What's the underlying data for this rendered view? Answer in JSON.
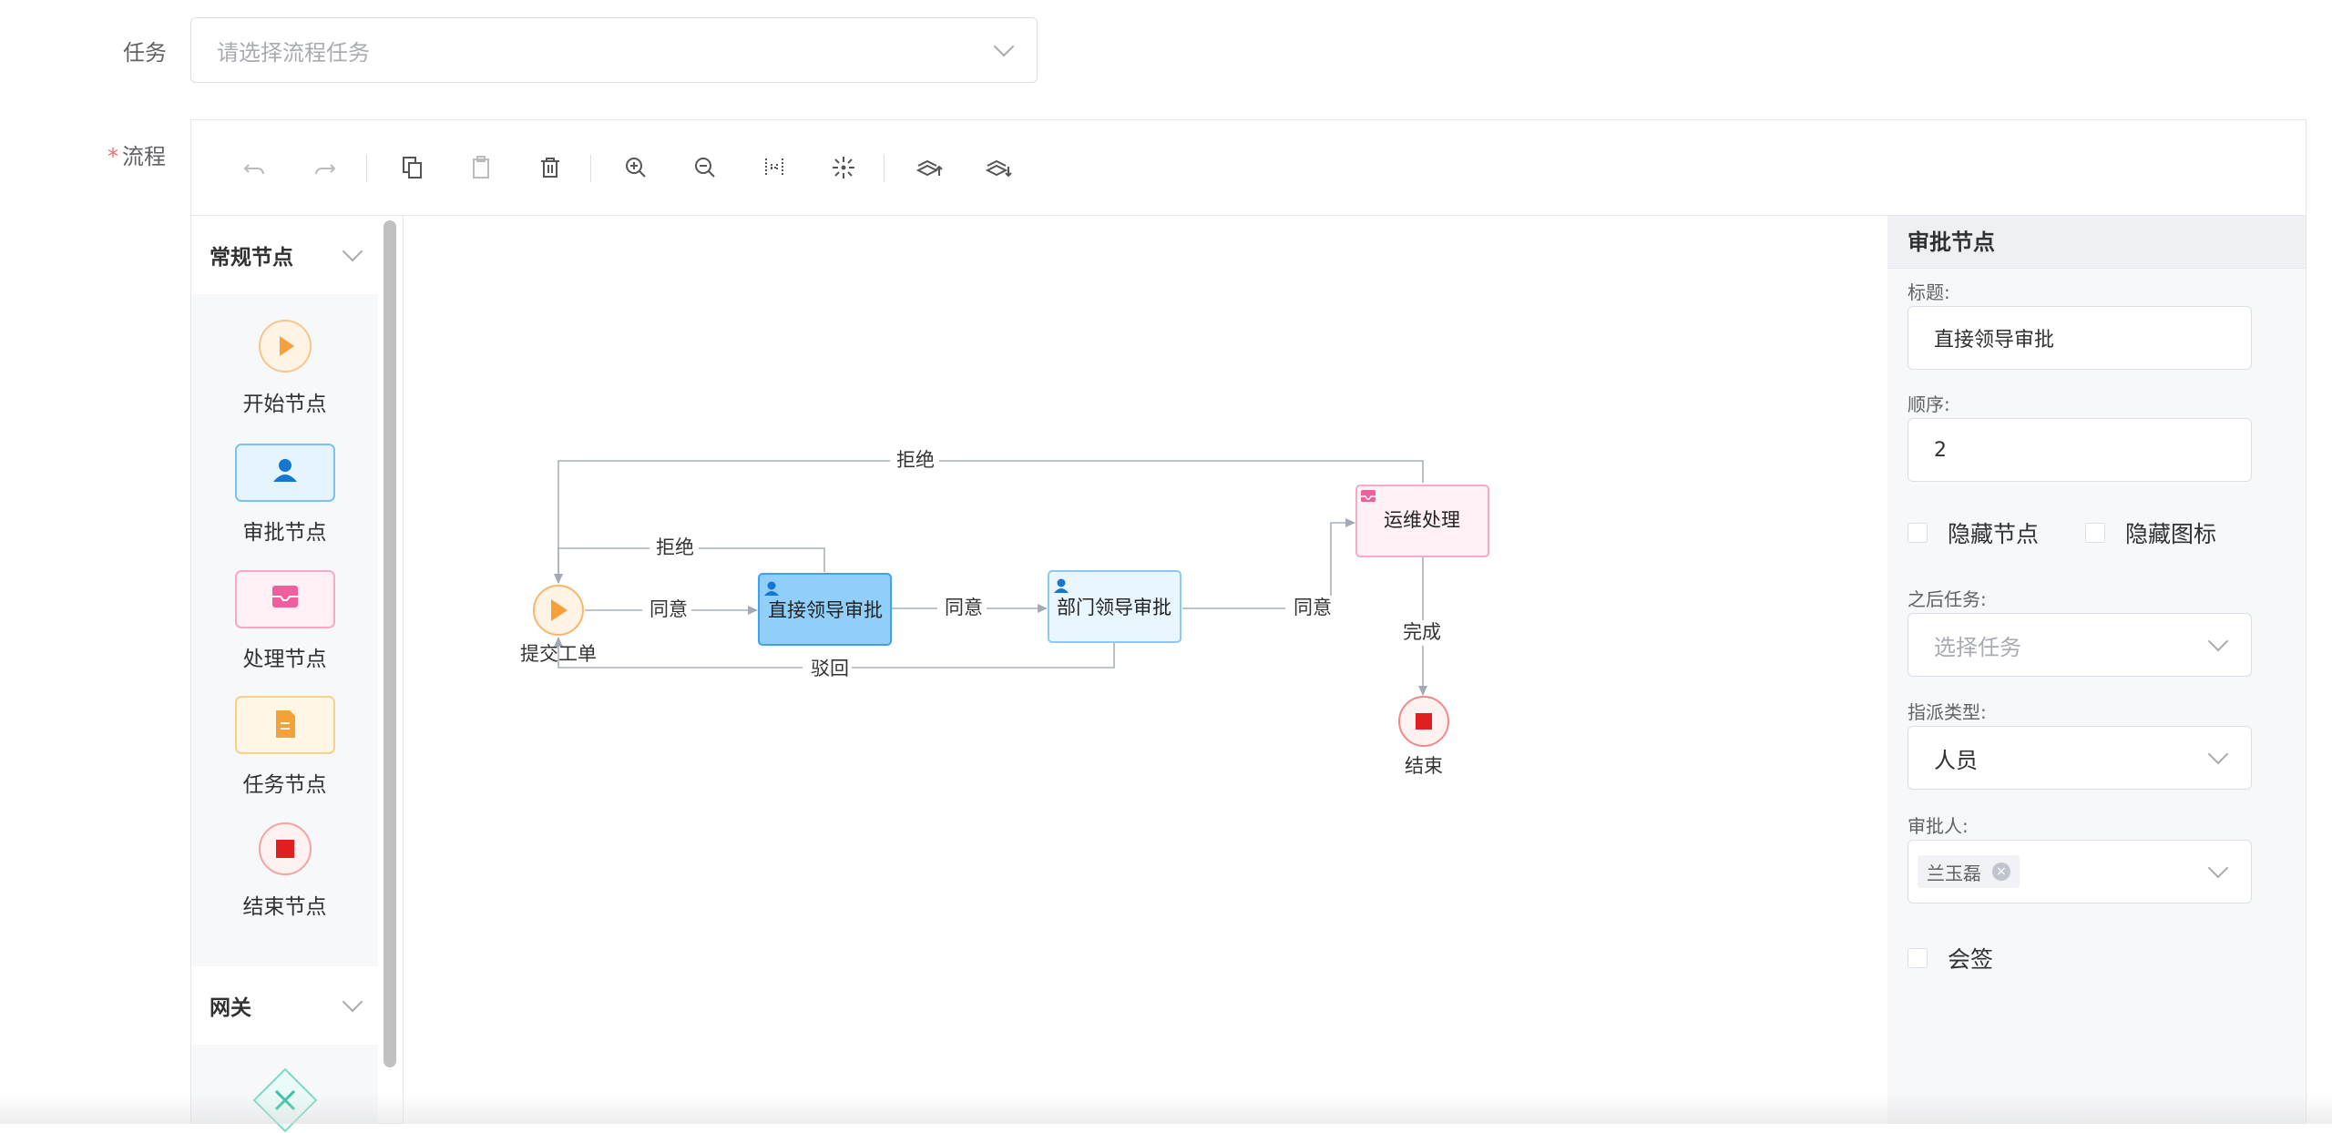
{
  "task_field": {
    "label": "任务",
    "placeholder": "请选择流程任务"
  },
  "flow_field": {
    "required_mark": "*",
    "label": "流程"
  },
  "toolbar": {
    "buttons": [
      "undo-icon",
      "redo-icon",
      "copy-icon",
      "paste-icon",
      "delete-icon",
      "zoom-in-icon",
      "zoom-out-icon",
      "fit-icon",
      "actual-size-icon",
      "import-icon",
      "export-icon"
    ]
  },
  "palette": {
    "group1": {
      "title": "常规节点"
    },
    "items": [
      {
        "label": "开始节点",
        "icon": "start-node-icon"
      },
      {
        "label": "审批节点",
        "icon": "approve-node-icon"
      },
      {
        "label": "处理节点",
        "icon": "handle-node-icon"
      },
      {
        "label": "任务节点",
        "icon": "task-node-icon"
      },
      {
        "label": "结束节点",
        "icon": "end-node-icon"
      }
    ],
    "group2": {
      "title": "网关"
    }
  },
  "diagram": {
    "nodes": {
      "start": {
        "label": "提交工单"
      },
      "direct": {
        "label": "直接领导审批"
      },
      "dept": {
        "label": "部门领导审批"
      },
      "ops": {
        "label": "运维处理"
      },
      "end": {
        "label": "结束"
      }
    },
    "edges": {
      "agree1": "同意",
      "agree2": "同意",
      "agree3": "同意",
      "reject_outer": "拒绝",
      "reject_inner": "拒绝",
      "rollback": "驳回",
      "complete": "完成"
    }
  },
  "props": {
    "title": "审批节点",
    "title_label": "标题:",
    "title_value": "直接领导审批",
    "order_label": "顺序:",
    "order_value": "2",
    "hide_node": "隐藏节点",
    "hide_icon": "隐藏图标",
    "next_task_label": "之后任务:",
    "next_task_placeholder": "选择任务",
    "assign_type_label": "指派类型:",
    "assign_type_value": "人员",
    "approver_label": "审批人:",
    "approver_tag": "兰玉磊",
    "countersign": "会签"
  },
  "colors": {
    "accent": "#409eff",
    "approve_fill": "#8fcff9",
    "start": "#f5a13a",
    "end": "#e02020"
  }
}
